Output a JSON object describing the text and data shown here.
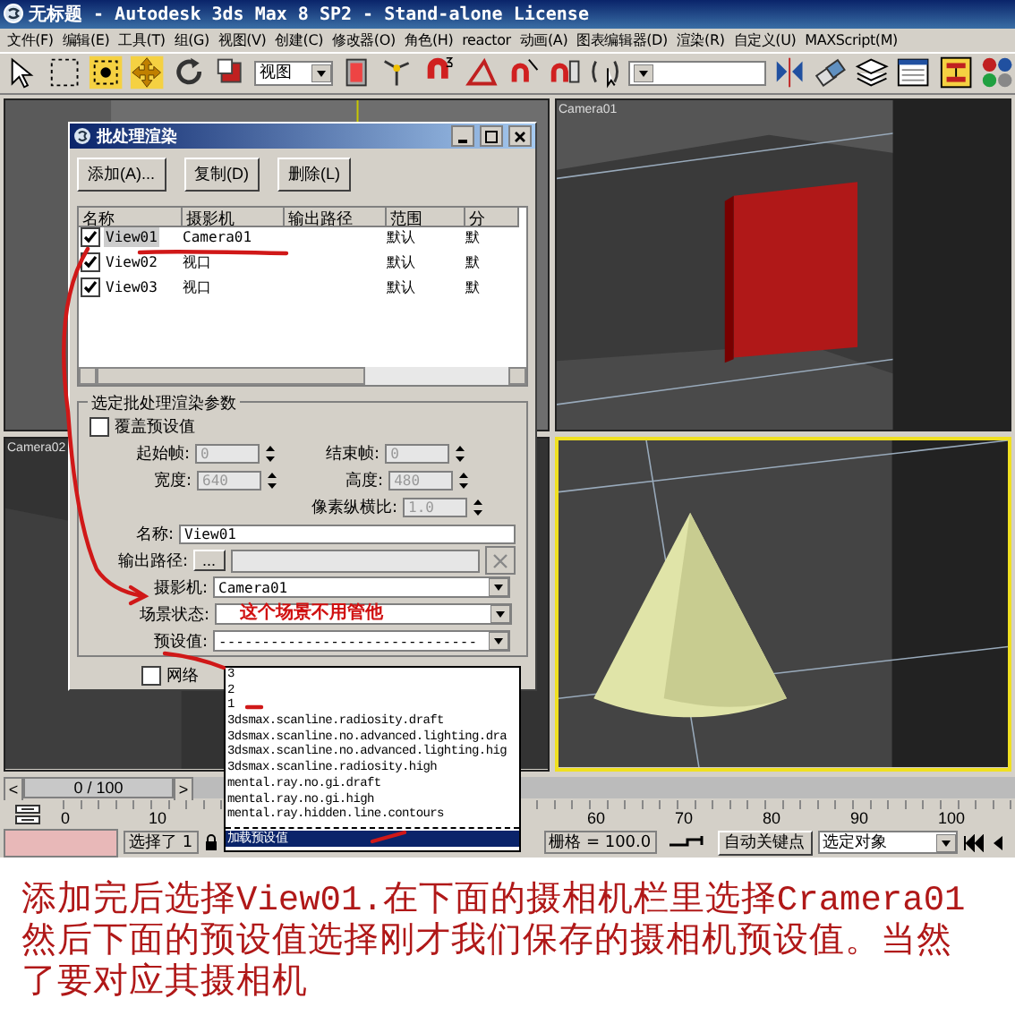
{
  "window": {
    "title": "无标题 - Autodesk 3ds Max 8 SP2 - Stand-alone License"
  },
  "menu": [
    "文件(F)",
    "编辑(E)",
    "工具(T)",
    "组(G)",
    "视图(V)",
    "创建(C)",
    "修改器(O)",
    "角色(H)",
    "reactor",
    "动画(A)",
    "图表编辑器(D)",
    "渲染(R)",
    "自定义(U)",
    "MAXScript(M)"
  ],
  "toolbar": {
    "view_dropdown": "视图"
  },
  "viewports": [
    {
      "active": false
    },
    {
      "label": "Camera01",
      "active": false
    },
    {
      "label": "Camera02",
      "active": false
    },
    {
      "active": true
    }
  ],
  "dialog": {
    "title": "批处理渲染",
    "buttons": [
      "添加(A)...",
      "复制(D)",
      "删除(L)"
    ],
    "columns": [
      "名称",
      "摄影机",
      "输出路径",
      "范围",
      "分"
    ],
    "rows": [
      {
        "checked": true,
        "selected": true,
        "name": "View01",
        "camera": "Camera01",
        "output": "",
        "range": "默认",
        "column_5": "默"
      },
      {
        "checked": true,
        "selected": false,
        "name": "View02",
        "camera": "视口",
        "output": "",
        "range": "默认",
        "column_5": "默"
      },
      {
        "checked": true,
        "selected": false,
        "name": "View03",
        "camera": "视口",
        "output": "",
        "range": "默认",
        "column_5": "默"
      }
    ],
    "group_title": "选定批处理渲染参数",
    "override": {
      "label": "覆盖预设值",
      "checked": false
    },
    "start_frame": {
      "label": "起始帧:",
      "value": "0",
      "disabled": true
    },
    "end_frame": {
      "label": "结束帧:",
      "value": "0",
      "disabled": true
    },
    "width": {
      "label": "宽度:",
      "value": "640",
      "disabled": true
    },
    "height": {
      "label": "高度:",
      "value": "480",
      "disabled": true
    },
    "aspect": {
      "label": "像素纵横比:",
      "value": "1.0",
      "disabled": true
    },
    "name": {
      "label": "名称:",
      "value": "View01"
    },
    "output_path": {
      "label": "输出路径:",
      "browse": "..."
    },
    "camera": {
      "label": "摄影机:",
      "value": "Camera01"
    },
    "scene_state": {
      "label": "场景状态:"
    },
    "preset": {
      "label": "预设值:",
      "value": "------------------------------"
    },
    "network": {
      "label": "网络",
      "checked": false
    }
  },
  "preset_list": {
    "presets": [
      {
        "label": "3",
        "selected": false
      },
      {
        "label": "2",
        "selected": false
      },
      {
        "label": "1",
        "selected": false
      },
      {
        "label": "3dsmax.scanline.radiosity.draft",
        "selected": false
      },
      {
        "label": "3dsmax.scanline.no.advanced.lighting.dra",
        "selected": false
      },
      {
        "label": "3dsmax.scanline.no.advanced.lighting.hig",
        "selected": false
      },
      {
        "label": "3dsmax.scanline.radiosity.high",
        "selected": false
      },
      {
        "label": "mental.ray.no.gi.draft",
        "selected": false
      },
      {
        "label": "mental.ray.no.gi.high",
        "selected": false
      },
      {
        "label": "mental.ray.hidden.line.contours",
        "selected": false
      }
    ],
    "actions": [
      {
        "label": "加载预设值",
        "selected": true
      }
    ]
  },
  "annotation": "这个场景不用管他",
  "time_slider": {
    "prev": "<",
    "position": "0 / 100",
    "next": ">",
    "level": 0
  },
  "ruler_ticks": [
    "0",
    "10",
    "60",
    "70",
    "80",
    "90",
    "100"
  ],
  "status_bar": {
    "selection": "选择了 1",
    "grid": "栅格 = 100.0",
    "auto_key": "自动关键点",
    "key_filter": "选定对象"
  },
  "caption": [
    "添加完后选择View01.在下面的摄相机栏里选择Cramera01",
    "然后下面的预设值选择刚才我们保存的摄相机预设值。当然",
    "了要对应其摄相机"
  ]
}
